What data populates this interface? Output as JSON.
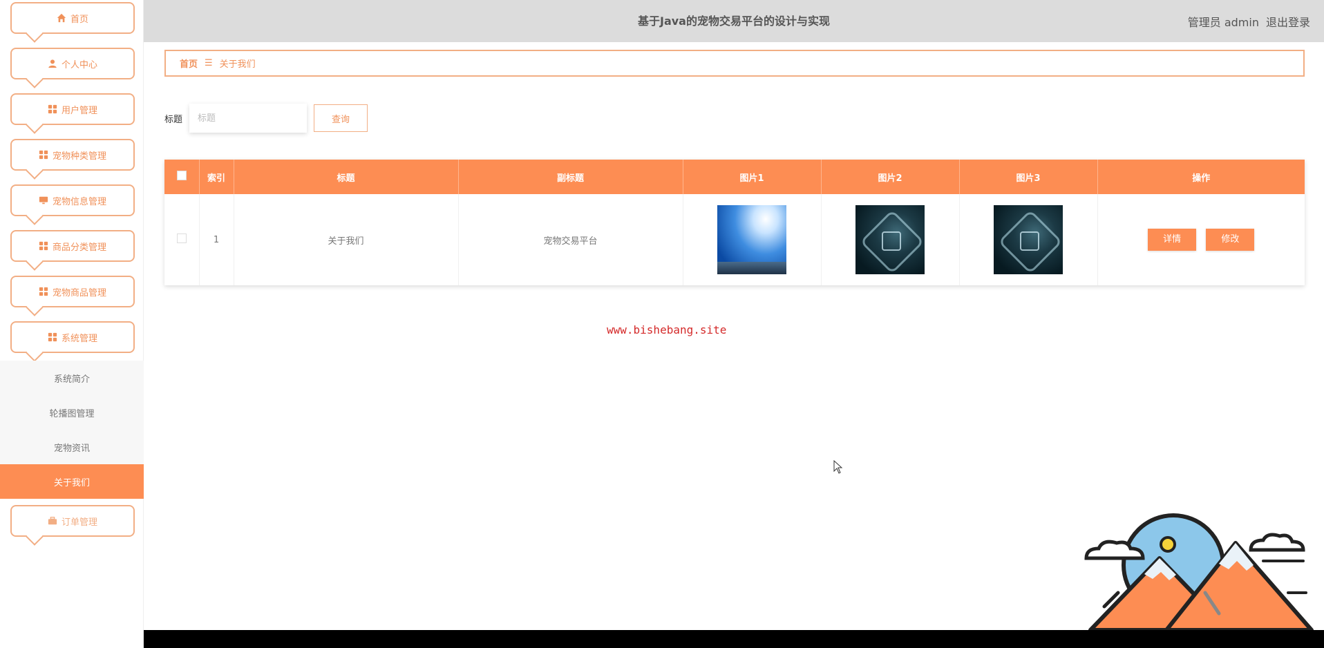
{
  "header": {
    "title": "基于Java的宠物交易平台的设计与实现",
    "admin": "管理员 admin",
    "logout": "退出登录"
  },
  "sidebar": {
    "items": [
      {
        "label": "首页",
        "icon": "home-icon"
      },
      {
        "label": "个人中心",
        "icon": "user-icon"
      },
      {
        "label": "用户管理",
        "icon": "grid-icon"
      },
      {
        "label": "宠物种类管理",
        "icon": "grid-icon"
      },
      {
        "label": "宠物信息管理",
        "icon": "monitor-icon"
      },
      {
        "label": "商品分类管理",
        "icon": "grid-icon"
      },
      {
        "label": "宠物商品管理",
        "icon": "grid-icon"
      },
      {
        "label": "系统管理",
        "icon": "grid-icon"
      },
      {
        "label": "订单管理",
        "icon": "briefcase-icon"
      }
    ],
    "submenu": [
      "系统简介",
      "轮播图管理",
      "宠物资讯",
      "关于我们"
    ],
    "active_submenu": "关于我们"
  },
  "breadcrumb": {
    "home": "首页",
    "separator": "☰",
    "current": "关于我们"
  },
  "search": {
    "label": "标题",
    "placeholder": "标题",
    "button": "查询"
  },
  "table": {
    "headers": [
      "索引",
      "标题",
      "副标题",
      "图片1",
      "图片2",
      "图片3",
      "操作"
    ],
    "rows": [
      {
        "index": "1",
        "title": "关于我们",
        "subtitle": "宠物交易平台"
      }
    ],
    "actions": {
      "detail": "详情",
      "edit": "修改"
    }
  },
  "watermark": "www.bishebang.site",
  "colors": {
    "accent": "#fd8d53",
    "border": "#f2ae84",
    "header_bg": "#dcdcdc",
    "watermark": "#d42a2a"
  }
}
